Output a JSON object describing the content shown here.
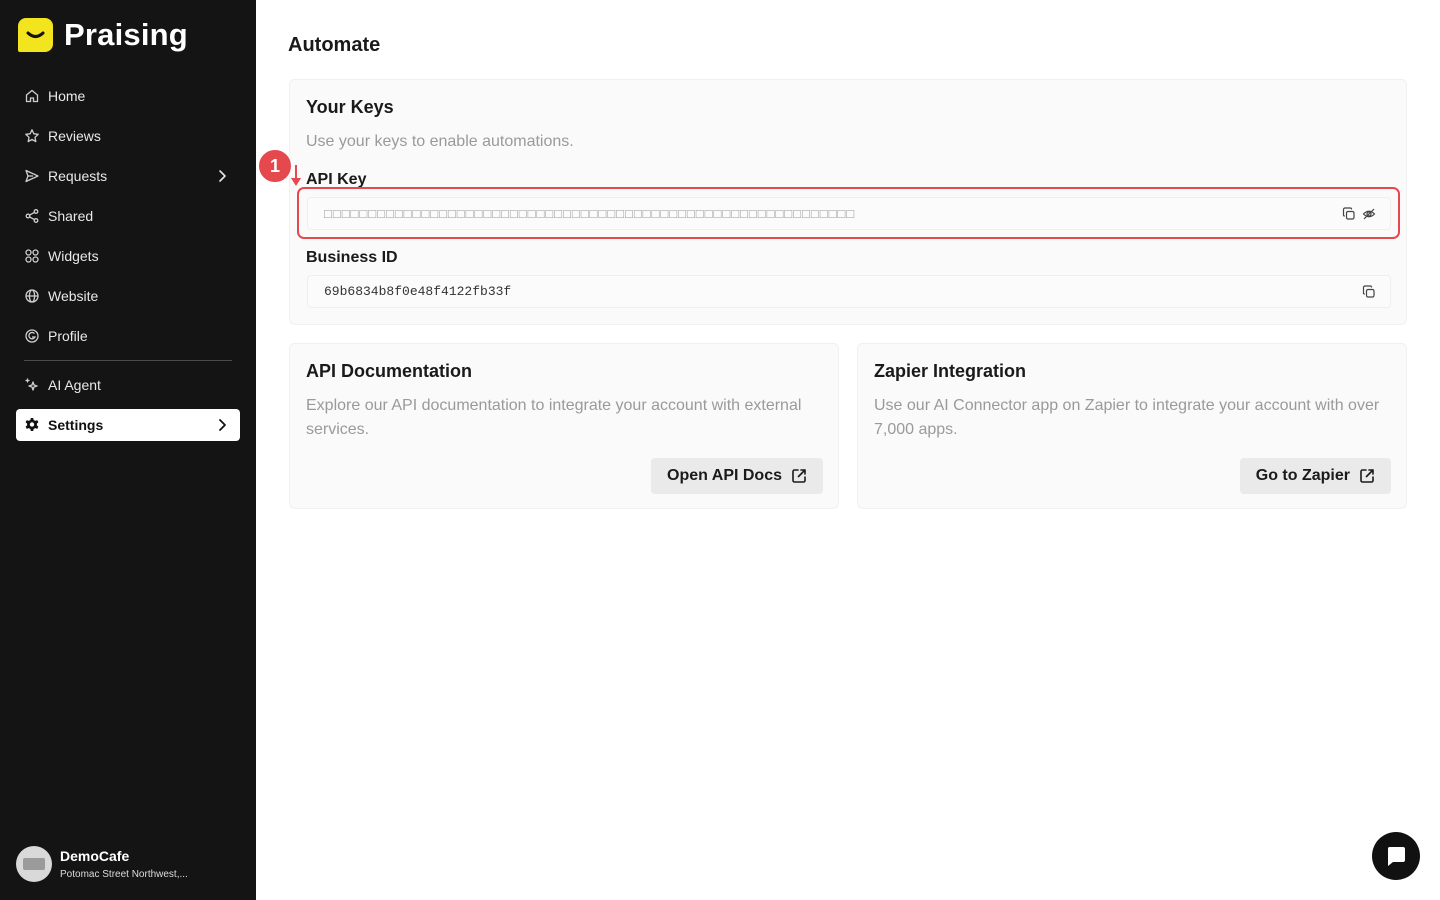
{
  "brand": {
    "name": "Praising",
    "logo_color": "#f2e51d"
  },
  "sidebar": {
    "items": [
      {
        "label": "Home",
        "icon": "home-icon"
      },
      {
        "label": "Reviews",
        "icon": "star-icon"
      },
      {
        "label": "Requests",
        "icon": "send-icon",
        "has_submenu": true
      },
      {
        "label": "Shared",
        "icon": "share-icon"
      },
      {
        "label": "Widgets",
        "icon": "widgets-icon"
      },
      {
        "label": "Website",
        "icon": "globe-icon"
      },
      {
        "label": "Profile",
        "icon": "profile-icon"
      },
      {
        "label": "AI Agent",
        "icon": "sparkles-icon"
      },
      {
        "label": "Settings",
        "icon": "gear-icon",
        "has_submenu": true,
        "active": true
      }
    ]
  },
  "account": {
    "name": "DemoCafe",
    "address": "Potomac Street Northwest,..."
  },
  "page": {
    "title": "Automate"
  },
  "keys_card": {
    "title": "Your Keys",
    "description": "Use your keys to enable automations.",
    "api_key_label": "API Key",
    "api_key_value": "□□□□□□□□□□□□□□□□□□□□□□□□□□□□□□□□□□□□□□□□□□□□□□□□□□□□□□□□□□□□",
    "business_id_label": "Business ID",
    "business_id_value": "69b6834b8f0e48f4122fb33f"
  },
  "annotation": {
    "step": "1",
    "color": "#e5484d"
  },
  "api_docs_card": {
    "title": "API Documentation",
    "description": "Explore our API documentation to integrate your account with external services.",
    "button_label": "Open API Docs"
  },
  "zapier_card": {
    "title": "Zapier Integration",
    "description": "Use our AI Connector app on Zapier to integrate your account with over 7,000 apps.",
    "button_label": "Go to Zapier"
  }
}
